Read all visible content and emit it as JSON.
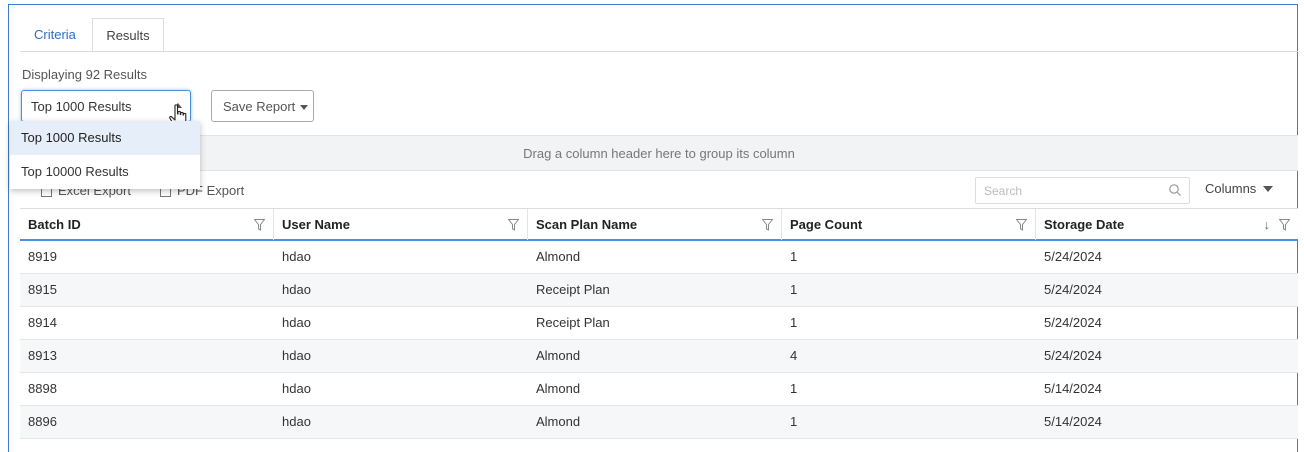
{
  "tabs": [
    {
      "label": "Criteria"
    },
    {
      "label": "Results"
    }
  ],
  "results_summary": "Displaying 92 Results",
  "result_limit": {
    "selected": "Top 1000 Results",
    "options": [
      "Top 1000 Results",
      "Top 10000 Results"
    ]
  },
  "save_report_label": "Save Report",
  "group_hint": "Drag a column header here to group its column",
  "export": {
    "excel_label": "Excel Export",
    "pdf_label": "PDF Export"
  },
  "search": {
    "placeholder": "Search"
  },
  "columns_label": "Columns",
  "table": {
    "headers": [
      "Batch ID",
      "User Name",
      "Scan Plan Name",
      "Page Count",
      "Storage Date"
    ],
    "sort_indicator": "↓",
    "rows": [
      [
        "8919",
        "hdao",
        "Almond",
        "1",
        "5/24/2024"
      ],
      [
        "8915",
        "hdao",
        "Receipt Plan",
        "1",
        "5/24/2024"
      ],
      [
        "8914",
        "hdao",
        "Receipt Plan",
        "1",
        "5/24/2024"
      ],
      [
        "8913",
        "hdao",
        "Almond",
        "4",
        "5/24/2024"
      ],
      [
        "8898",
        "hdao",
        "Almond",
        "1",
        "5/14/2024"
      ],
      [
        "8896",
        "hdao",
        "Almond",
        "1",
        "5/14/2024"
      ]
    ]
  },
  "colors": {
    "accent": "#4a8fe0",
    "link": "#2a6fc9",
    "selected_option_bg": "#e6eefa"
  }
}
